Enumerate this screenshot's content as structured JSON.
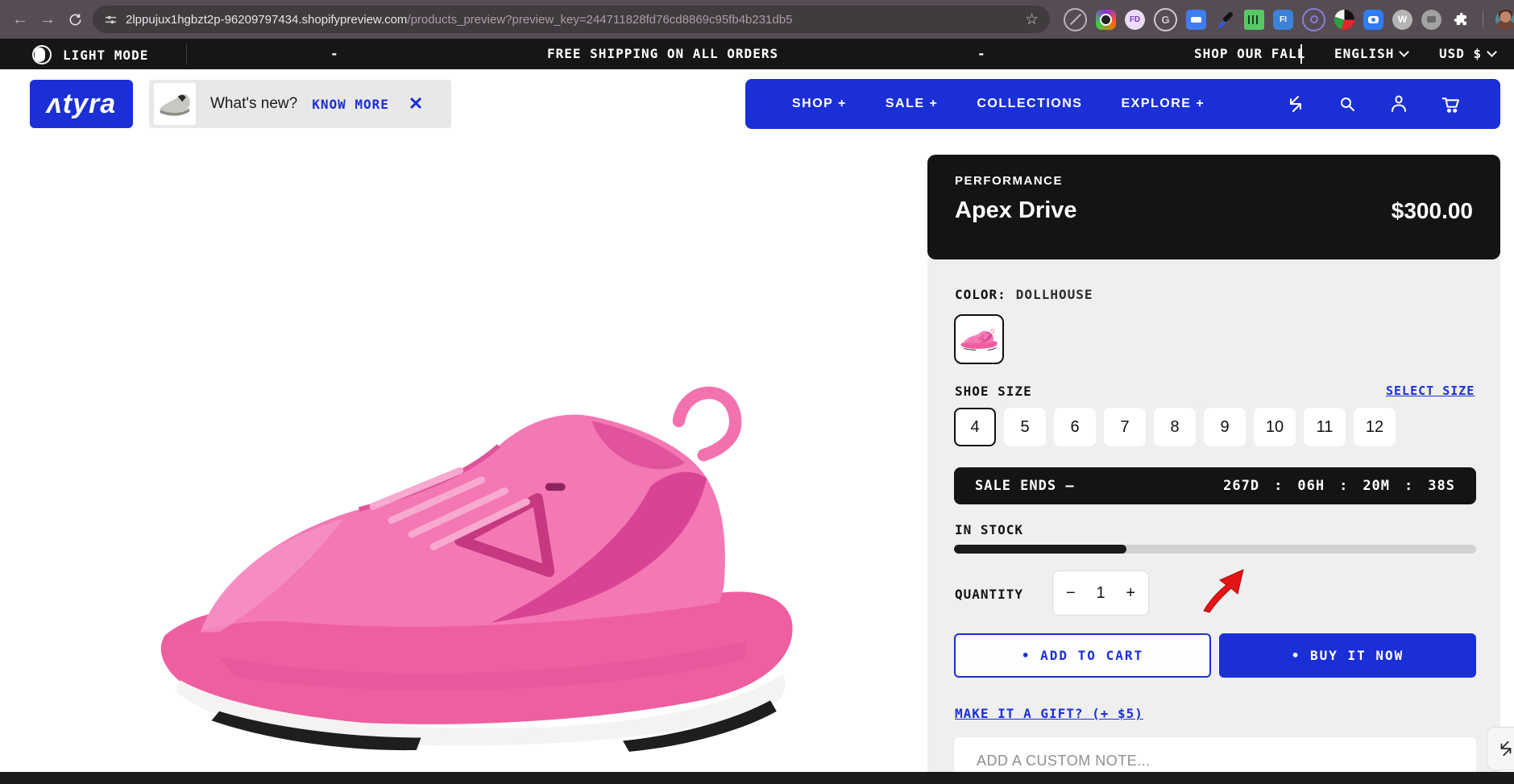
{
  "browser": {
    "url_host": "2lppujux1hgbzt2p-96209797434.shopifypreview.com",
    "url_path": "/products_preview?preview_key=244711828fd76cd8869c95fb4b231db5",
    "back": "←",
    "forward": "→",
    "bookmark_star": "☆",
    "ext_fd": "FD",
    "ext_g": "G",
    "ext_fi": "FI",
    "ext_w": "W"
  },
  "announcement": {
    "light_mode": "LIGHT MODE",
    "dash1": "-",
    "shipping": "FREE SHIPPING ON ALL ORDERS",
    "dash2": "-",
    "ticker": "SHOP OUR FALL",
    "language": "ENGLISH",
    "currency": "USD $"
  },
  "header": {
    "logo": "ʌtyra",
    "whats_new_text": "What's new?",
    "know_more": "KNOW MORE",
    "close": "✕",
    "nav_shop": "SHOP +",
    "nav_sale": "SALE +",
    "nav_collections": "COLLECTIONS",
    "nav_explore": "EXPLORE +"
  },
  "product": {
    "category": "PERFORMANCE",
    "title": "Apex Drive",
    "price": "$300.00",
    "color_label": "COLOR:",
    "color_value": "DOLLHOUSE",
    "size_label": "SHOE SIZE",
    "select_size": "SELECT SIZE",
    "sizes": [
      "4",
      "5",
      "6",
      "7",
      "8",
      "9",
      "10",
      "11",
      "12"
    ],
    "selected_size": "4",
    "sale_label": "SALE ENDS —",
    "timer": {
      "d": "267D",
      "h": "06H",
      "m": "20M",
      "s": "38S",
      "sep": ":"
    },
    "stock_label": "IN STOCK",
    "stock_percent": 33,
    "quantity_label": "QUANTITY",
    "quantity": "1",
    "minus": "−",
    "plus": "+",
    "add_to_cart": "• ADD TO CART",
    "buy_now": "• BUY IT NOW",
    "gift": "MAKE IT A GIFT? (+ $5)",
    "note_placeholder": "ADD A CUSTOM NOTE..."
  },
  "colors": {
    "brand_blue": "#1b2fd6",
    "panel_black": "#141414",
    "column_gray": "#efefef",
    "shoe_pink": "#f272ae",
    "annotation_red": "#e51414"
  }
}
